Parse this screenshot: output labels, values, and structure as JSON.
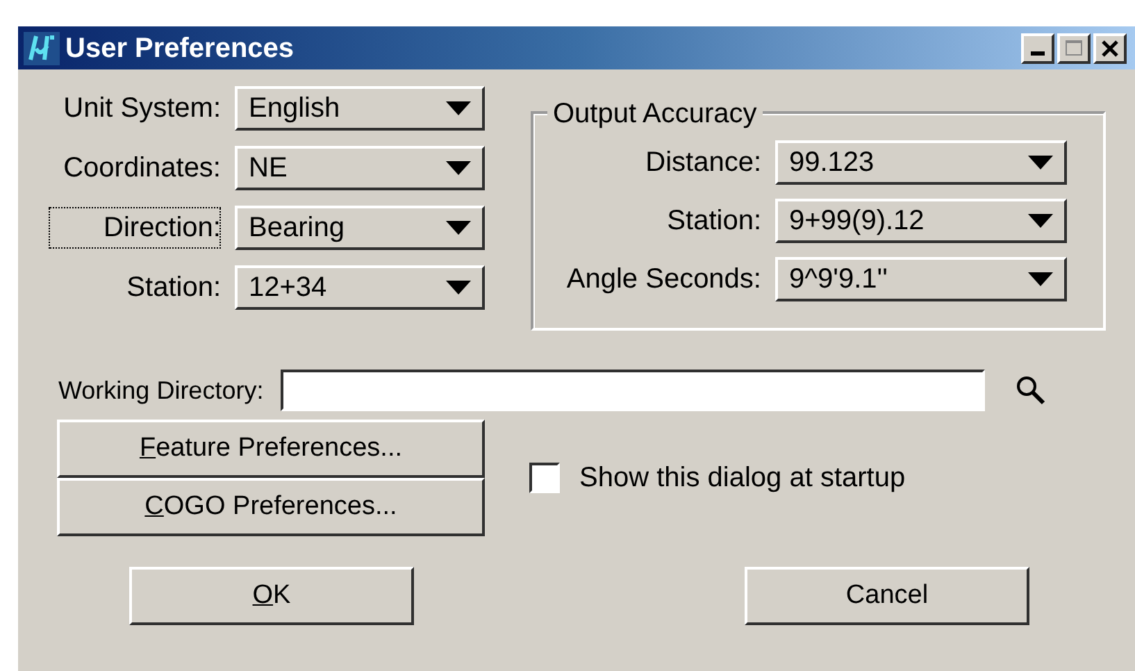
{
  "window": {
    "title": "User Preferences"
  },
  "settings": [
    {
      "label": "Unit System:",
      "value": "English",
      "focused": false
    },
    {
      "label": "Coordinates:",
      "value": "NE",
      "focused": false
    },
    {
      "label": "Direction:",
      "value": "Bearing",
      "focused": true
    },
    {
      "label": "Station:",
      "value": "12+34",
      "focused": false
    }
  ],
  "output_accuracy": {
    "title": "Output Accuracy",
    "fields": [
      {
        "label": "Distance:",
        "value": "99.123"
      },
      {
        "label": "Station:",
        "value": "9+99(9).12"
      },
      {
        "label": "Angle Seconds:",
        "value": "9^9'9.1''"
      }
    ]
  },
  "working_directory": {
    "label": "Working Directory:"
  },
  "preference_buttons": [
    {
      "label": "Feature Preferences...",
      "underline_first": true
    },
    {
      "label": "COGO Preferences...",
      "underline_first": true
    }
  ],
  "startup_checkbox": {
    "label": "Show this dialog at startup",
    "checked": false
  },
  "buttons": [
    {
      "label": "OK",
      "underline_first": true
    },
    {
      "label": "Cancel",
      "underline_first": false
    }
  ]
}
